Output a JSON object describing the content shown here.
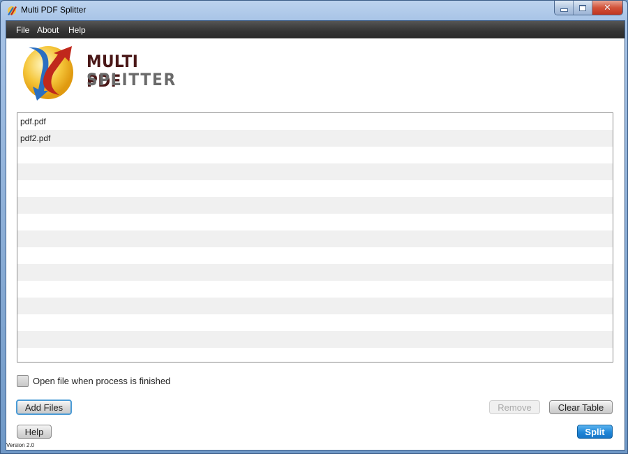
{
  "window": {
    "title": "Multi PDF Splitter",
    "controls": {
      "minimize": "minimize",
      "maximize": "maximize",
      "close": "close"
    }
  },
  "menu": [
    "File",
    "About",
    "Help"
  ],
  "logo": {
    "line1": "MULTI PDF",
    "line2": "SPLITTER"
  },
  "files": [
    "pdf.pdf",
    "pdf2.pdf",
    "",
    "",
    "",
    "",
    "",
    "",
    "",
    "",
    "",
    "",
    "",
    "",
    ""
  ],
  "options": {
    "open_when_finished_label": "Open file when process is finished",
    "open_when_finished_checked": false
  },
  "buttons": {
    "add_files": "Add Files",
    "remove": "Remove",
    "clear_table": "Clear Table",
    "help": "Help",
    "split": "Split"
  },
  "version": "Version 2.0",
  "colors": {
    "accent": "#1f86d8",
    "menubar": "#333333",
    "row_alt": "#f0f0f0"
  }
}
